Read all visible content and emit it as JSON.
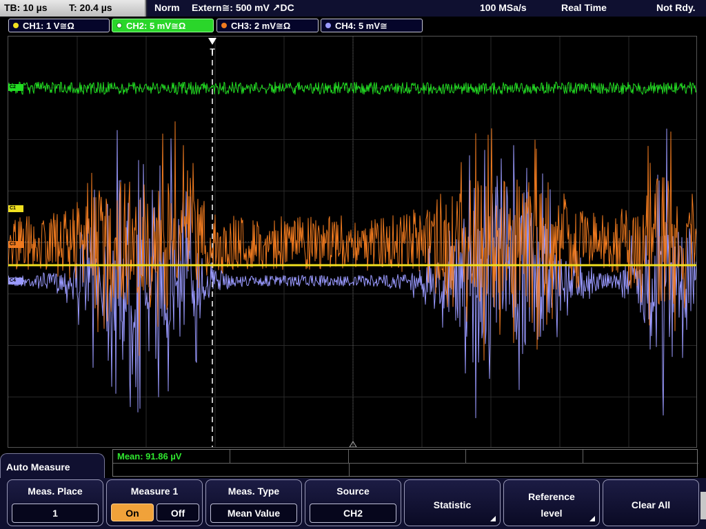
{
  "topbar": {
    "timebase": "TB: 10 µs",
    "trigger_time": "T: 20.4 µs",
    "mode": "Norm",
    "trigger_source": "Extern≅: 500 mV ↗DC",
    "sample_rate": "100 MSa/s",
    "acq_mode": "Real Time",
    "status": "Not Rdy."
  },
  "channels": [
    {
      "label": "CH1: 1 V≅Ω",
      "color": "#f0e020",
      "marker": "C1"
    },
    {
      "label": "CH2: 5 mV≅Ω",
      "color": "#22dd22",
      "marker": "C2"
    },
    {
      "label": "CH3: 2 mV≅Ω",
      "color": "#ef7a1f",
      "marker": "C3"
    },
    {
      "label": "CH4: 5 mV≅",
      "color": "#9a9aff",
      "marker": "C4"
    }
  ],
  "trigger_marker": "T",
  "measurement": {
    "result": "Mean: 91.86 µV"
  },
  "menu": {
    "title": "Auto Measure",
    "meas_place_label": "Meas. Place",
    "meas_place_value": "1",
    "measure1_label": "Measure 1",
    "on_label": "On",
    "off_label": "Off",
    "meas_type_label": "Meas. Type",
    "meas_type_value": "Mean Value",
    "source_label": "Source",
    "source_value": "CH2",
    "statistic_label": "Statistic",
    "reference_label_1": "Reference",
    "reference_label_2": "level",
    "clear_all_label": "Clear All"
  }
}
